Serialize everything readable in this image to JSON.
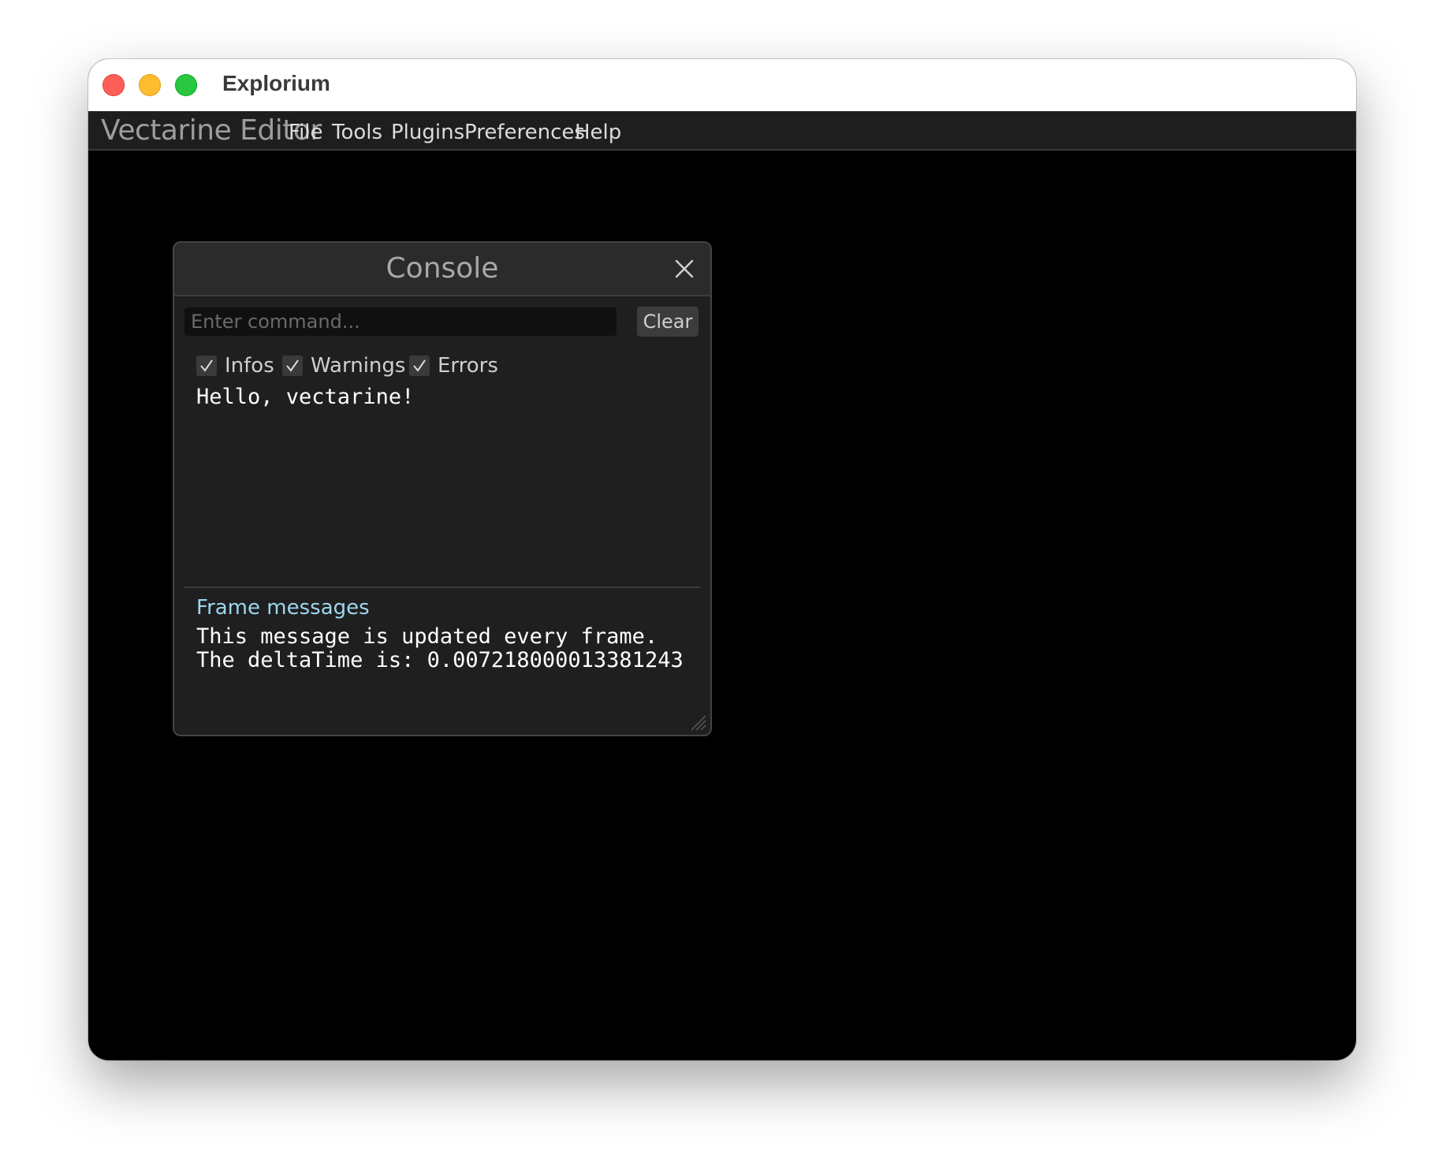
{
  "window": {
    "title": "Explorium"
  },
  "menubar": {
    "app_name": "Vectarine Editor",
    "items": [
      {
        "label": "File"
      },
      {
        "label": "Tools"
      },
      {
        "label": "Plugins"
      },
      {
        "label": "Preferences"
      },
      {
        "label": "Help"
      }
    ]
  },
  "console": {
    "title": "Console",
    "command_placeholder": "Enter command...",
    "command_value": "",
    "clear_label": "Clear",
    "filters": [
      {
        "label": "Infos",
        "checked": true
      },
      {
        "label": "Warnings",
        "checked": true
      },
      {
        "label": "Errors",
        "checked": true
      }
    ],
    "log_lines": [
      "Hello, vectarine!"
    ],
    "frame_messages": {
      "header": "Frame messages",
      "lines": [
        "This message is updated every frame.",
        "The deltaTime is: 0.007218000013381243"
      ]
    }
  },
  "colors": {
    "desktop_bg": "#000000",
    "menubar_bg": "#1e1e1e",
    "panel_bg": "#1f1f1f",
    "frame_header_accent": "#9dd6ee",
    "traffic_red": "#fe5f57",
    "traffic_yellow": "#febc2e",
    "traffic_green": "#28c840"
  }
}
